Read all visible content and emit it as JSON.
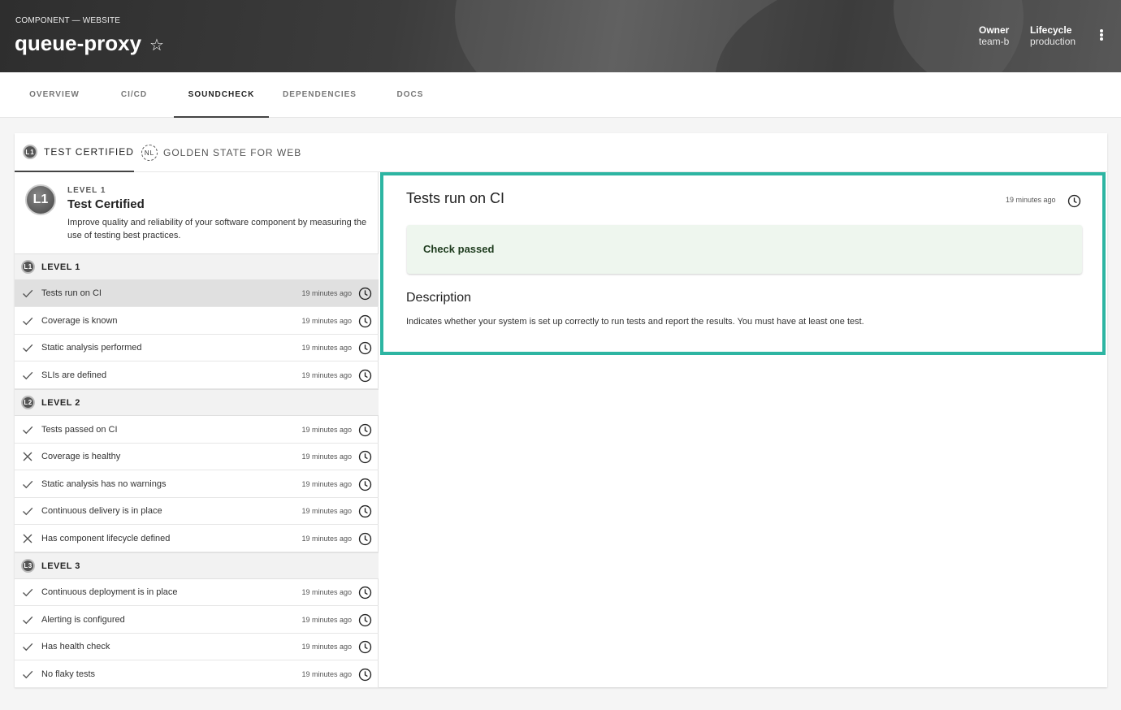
{
  "header": {
    "kind": "COMPONENT — WEBSITE",
    "title": "queue-proxy",
    "owner_label": "Owner",
    "owner_value": "team-b",
    "lifecycle_label": "Lifecycle",
    "lifecycle_value": "production"
  },
  "tabs": [
    "OVERVIEW",
    "CI/CD",
    "SOUNDCHECK",
    "DEPENDENCIES",
    "DOCS"
  ],
  "active_tab": "SOUNDCHECK",
  "subtabs": {
    "certified": {
      "badge": "L1",
      "label": "TEST CERTIFIED"
    },
    "golden": {
      "badge": "NL",
      "label": "GOLDEN STATE FOR WEB"
    }
  },
  "intro": {
    "badge": "L1",
    "level": "LEVEL 1",
    "name": "Test Certified",
    "description": "Improve quality and reliability of your software component by measuring the use of testing best practices."
  },
  "groups": [
    {
      "badge": "L1",
      "label": "LEVEL 1"
    },
    {
      "badge": "L2",
      "label": "LEVEL 2"
    },
    {
      "badge": "L3",
      "label": "LEVEL 3"
    }
  ],
  "checks": [
    {
      "label": "Tests run on CI",
      "time": "19 minutes ago",
      "status": "pass"
    },
    {
      "label": "Coverage is known",
      "time": "19 minutes ago",
      "status": "pass"
    },
    {
      "label": "Static analysis performed",
      "time": "19 minutes ago",
      "status": "pass"
    },
    {
      "label": "SLIs are defined",
      "time": "19 minutes ago",
      "status": "pass"
    },
    {
      "label": "Tests passed on CI",
      "time": "19 minutes ago",
      "status": "pass"
    },
    {
      "label": "Coverage is healthy",
      "time": "19 minutes ago",
      "status": "fail"
    },
    {
      "label": "Static analysis has no warnings",
      "time": "19 minutes ago",
      "status": "pass"
    },
    {
      "label": "Continuous delivery is in place",
      "time": "19 minutes ago",
      "status": "pass"
    },
    {
      "label": "Has component lifecycle defined",
      "time": "19 minutes ago",
      "status": "fail"
    },
    {
      "label": "Continuous deployment is in place",
      "time": "19 minutes ago",
      "status": "pass"
    },
    {
      "label": "Alerting is configured",
      "time": "19 minutes ago",
      "status": "pass"
    },
    {
      "label": "Has health check",
      "time": "19 minutes ago",
      "status": "pass"
    },
    {
      "label": "No flaky tests",
      "time": "19 minutes ago",
      "status": "pass"
    }
  ],
  "detail": {
    "title": "Tests run on CI",
    "time": "19 minutes ago",
    "result": "Check passed",
    "description_heading": "Description",
    "description": "Indicates whether your system is set up correctly to run tests and report the results. You must have at least one test."
  },
  "colors": {
    "accent": "#2db5a2",
    "pass_bg": "#eef6ee"
  },
  "icons": {
    "favorite": "star-icon",
    "menu": "more-vertical-icon",
    "pass": "check-icon",
    "fail": "close-icon",
    "time": "clock-icon"
  }
}
